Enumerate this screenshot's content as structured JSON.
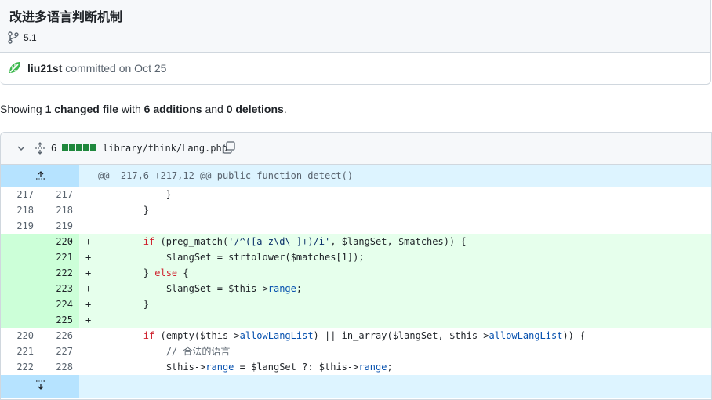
{
  "commit": {
    "title": "改进多语言判断机制",
    "branch": "5.1",
    "author": "liu21st",
    "committed_text": "committed on Oct 25"
  },
  "summary": {
    "prefix": "Showing",
    "changed": "1 changed file",
    "with": "with",
    "additions": "6 additions",
    "and": "and",
    "deletions": "0 deletions",
    "period": "."
  },
  "file": {
    "change_count": "6",
    "path": "library/think/Lang.php",
    "hunk_header": "@@ -217,6 +217,12 @@ public function detect()"
  },
  "lines": [
    {
      "old": "217",
      "new": "217",
      "type": "ctx",
      "sign": "",
      "code": "            }"
    },
    {
      "old": "218",
      "new": "218",
      "type": "ctx",
      "sign": "",
      "code": "        }"
    },
    {
      "old": "219",
      "new": "219",
      "type": "ctx",
      "sign": "",
      "code": ""
    },
    {
      "old": "",
      "new": "220",
      "type": "add",
      "sign": "+",
      "code": "        if (preg_match('/^([a-z\\d\\-]+)/i', $langSet, $matches)) {"
    },
    {
      "old": "",
      "new": "221",
      "type": "add",
      "sign": "+",
      "code": "            $langSet = strtolower($matches[1]);"
    },
    {
      "old": "",
      "new": "222",
      "type": "add",
      "sign": "+",
      "code": "        } else {"
    },
    {
      "old": "",
      "new": "223",
      "type": "add",
      "sign": "+",
      "code": "            $langSet = $this->range;"
    },
    {
      "old": "",
      "new": "224",
      "type": "add",
      "sign": "+",
      "code": "        }"
    },
    {
      "old": "",
      "new": "225",
      "type": "add",
      "sign": "+",
      "code": ""
    },
    {
      "old": "220",
      "new": "226",
      "type": "ctx",
      "sign": "",
      "code": "        if (empty($this->allowLangList) || in_array($langSet, $this->allowLangList)) {"
    },
    {
      "old": "221",
      "new": "227",
      "type": "ctx",
      "sign": "",
      "code": "            // 合法的语言"
    },
    {
      "old": "222",
      "new": "228",
      "type": "ctx",
      "sign": "",
      "code": "            $this->range = $langSet ?: $this->range;"
    }
  ],
  "icons": {
    "branch": "git-branch-icon",
    "avatar": "leaf-avatar-icon",
    "chevron": "chevron-down-icon",
    "expand": "unfold-icon",
    "copy": "copy-icon",
    "expand_up": "expand-up-icon",
    "expand_down": "expand-down-icon"
  },
  "colors": {
    "addition_bg": "#e6ffec",
    "addition_gutter": "#ccffd8",
    "hunk_bg": "#ddf4ff",
    "hunk_gutter": "#b6e3ff",
    "diffstat_green": "#1f883d",
    "avatar_green": "#3fb950"
  }
}
